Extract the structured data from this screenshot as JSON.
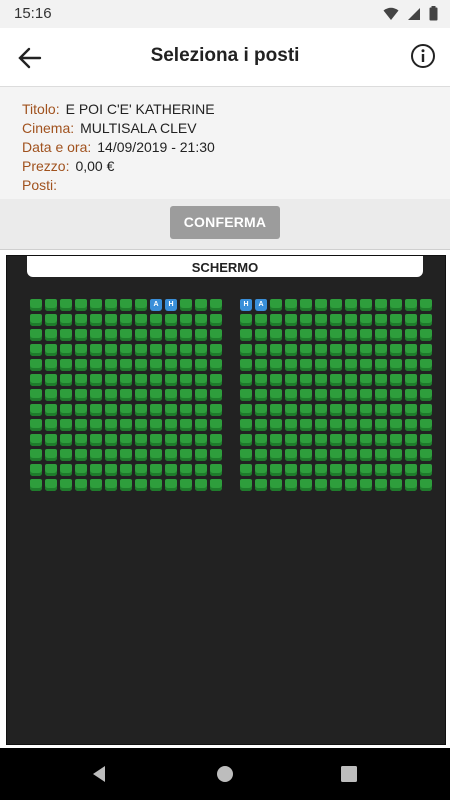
{
  "status": {
    "time": "15:16"
  },
  "appbar": {
    "title": "Seleziona i posti"
  },
  "details": [
    {
      "label": "Titolo:",
      "value": "E POI C'E' KATHERINE"
    },
    {
      "label": "Cinema:",
      "value": "MULTISALA CLEV"
    },
    {
      "label": "Data e ora:",
      "value": "14/09/2019 - 21:30"
    },
    {
      "label": "Prezzo:",
      "value": "0,00 €"
    },
    {
      "label": "Posti:",
      "value": ""
    }
  ],
  "confirm": {
    "label": "CONFERMA"
  },
  "screen": {
    "label": "SCHERMO"
  },
  "seating": {
    "rows": 13,
    "cols_per_block": 13,
    "left_first_row": "........AH...",
    "right_first_row": "HA...........",
    "last_row_index_left": 12,
    "available_color": "#2e9e3c",
    "special_color": "#3a8fd9"
  },
  "colors": {
    "label_accent": "#a0521e",
    "hall_bg": "#222222"
  }
}
